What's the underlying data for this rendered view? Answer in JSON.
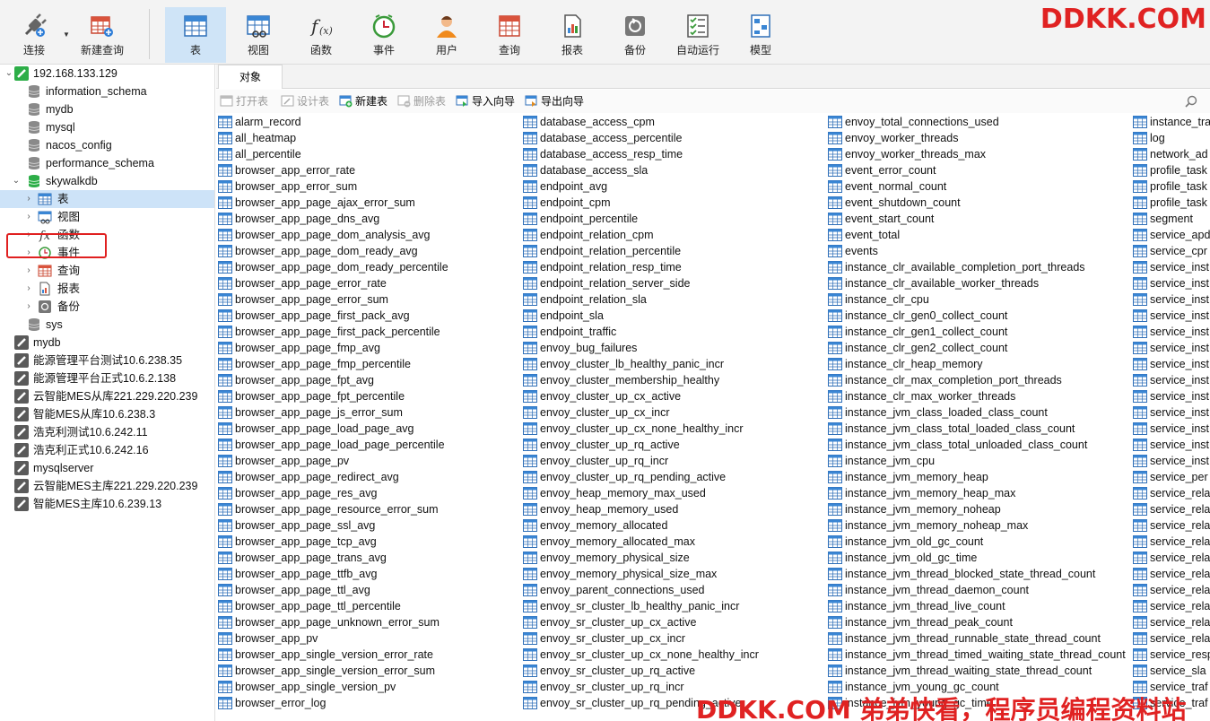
{
  "toolbar": {
    "buttons": [
      {
        "label": "连接",
        "icon": "plug-icon"
      },
      {
        "label": "新建查询",
        "icon": "new-query-icon"
      },
      {
        "label": "表",
        "icon": "table-icon"
      },
      {
        "label": "视图",
        "icon": "view-icon"
      },
      {
        "label": "函数",
        "icon": "function-icon"
      },
      {
        "label": "事件",
        "icon": "clock-icon"
      },
      {
        "label": "用户",
        "icon": "user-icon"
      },
      {
        "label": "查询",
        "icon": "query-icon"
      },
      {
        "label": "报表",
        "icon": "report-icon"
      },
      {
        "label": "备份",
        "icon": "backup-icon"
      },
      {
        "label": "自动运行",
        "icon": "auto-run-icon"
      },
      {
        "label": "模型",
        "icon": "model-icon"
      }
    ]
  },
  "watermark": {
    "top": "DDKK.COM",
    "bottom": "DDKK.COM 弟弟快看，程序员编程资料站"
  },
  "sidebar": {
    "connection": "192.168.133.129",
    "databases": [
      "information_schema",
      "mydb",
      "mysql",
      "nacos_config",
      "performance_schema"
    ],
    "open_db": "skywalkdb",
    "open_db_children": [
      "表",
      "视图",
      "函数",
      "事件",
      "查询",
      "报表",
      "备份"
    ],
    "after_db": "sys",
    "connections": [
      "mydb",
      "能源管理平台测试10.6.238.35",
      "能源管理平台正式10.6.2.138",
      "云智能MES从库221.229.220.239",
      "智能MES从库10.6.238.3",
      "浩克利测试10.6.242.11",
      "浩克利正式10.6.242.16",
      "mysqlserver",
      "云智能MES主库221.229.220.239",
      "智能MES主库10.6.239.13"
    ]
  },
  "tabs": {
    "objects": "对象"
  },
  "subtoolbar": {
    "open_table": "打开表",
    "design_table": "设计表",
    "new_table": "新建表",
    "delete_table": "删除表",
    "import_wizard": "导入向导",
    "export_wizard": "导出向导"
  },
  "tables": {
    "col1": [
      "alarm_record",
      "all_heatmap",
      "all_percentile",
      "browser_app_error_rate",
      "browser_app_error_sum",
      "browser_app_page_ajax_error_sum",
      "browser_app_page_dns_avg",
      "browser_app_page_dom_analysis_avg",
      "browser_app_page_dom_ready_avg",
      "browser_app_page_dom_ready_percentile",
      "browser_app_page_error_rate",
      "browser_app_page_error_sum",
      "browser_app_page_first_pack_avg",
      "browser_app_page_first_pack_percentile",
      "browser_app_page_fmp_avg",
      "browser_app_page_fmp_percentile",
      "browser_app_page_fpt_avg",
      "browser_app_page_fpt_percentile",
      "browser_app_page_js_error_sum",
      "browser_app_page_load_page_avg",
      "browser_app_page_load_page_percentile",
      "browser_app_page_pv",
      "browser_app_page_redirect_avg",
      "browser_app_page_res_avg",
      "browser_app_page_resource_error_sum",
      "browser_app_page_ssl_avg",
      "browser_app_page_tcp_avg",
      "browser_app_page_trans_avg",
      "browser_app_page_ttfb_avg",
      "browser_app_page_ttl_avg",
      "browser_app_page_ttl_percentile",
      "browser_app_page_unknown_error_sum",
      "browser_app_pv",
      "browser_app_single_version_error_rate",
      "browser_app_single_version_error_sum",
      "browser_app_single_version_pv",
      "browser_error_log"
    ],
    "col2": [
      "database_access_cpm",
      "database_access_percentile",
      "database_access_resp_time",
      "database_access_sla",
      "endpoint_avg",
      "endpoint_cpm",
      "endpoint_percentile",
      "endpoint_relation_cpm",
      "endpoint_relation_percentile",
      "endpoint_relation_resp_time",
      "endpoint_relation_server_side",
      "endpoint_relation_sla",
      "endpoint_sla",
      "endpoint_traffic",
      "envoy_bug_failures",
      "envoy_cluster_lb_healthy_panic_incr",
      "envoy_cluster_membership_healthy",
      "envoy_cluster_up_cx_active",
      "envoy_cluster_up_cx_incr",
      "envoy_cluster_up_cx_none_healthy_incr",
      "envoy_cluster_up_rq_active",
      "envoy_cluster_up_rq_incr",
      "envoy_cluster_up_rq_pending_active",
      "envoy_heap_memory_max_used",
      "envoy_heap_memory_used",
      "envoy_memory_allocated",
      "envoy_memory_allocated_max",
      "envoy_memory_physical_size",
      "envoy_memory_physical_size_max",
      "envoy_parent_connections_used",
      "envoy_sr_cluster_lb_healthy_panic_incr",
      "envoy_sr_cluster_up_cx_active",
      "envoy_sr_cluster_up_cx_incr",
      "envoy_sr_cluster_up_cx_none_healthy_incr",
      "envoy_sr_cluster_up_rq_active",
      "envoy_sr_cluster_up_rq_incr",
      "envoy_sr_cluster_up_rq_pending_active"
    ],
    "col3": [
      "envoy_total_connections_used",
      "envoy_worker_threads",
      "envoy_worker_threads_max",
      "event_error_count",
      "event_normal_count",
      "event_shutdown_count",
      "event_start_count",
      "event_total",
      "events",
      "instance_clr_available_completion_port_threads",
      "instance_clr_available_worker_threads",
      "instance_clr_cpu",
      "instance_clr_gen0_collect_count",
      "instance_clr_gen1_collect_count",
      "instance_clr_gen2_collect_count",
      "instance_clr_heap_memory",
      "instance_clr_max_completion_port_threads",
      "instance_clr_max_worker_threads",
      "instance_jvm_class_loaded_class_count",
      "instance_jvm_class_total_loaded_class_count",
      "instance_jvm_class_total_unloaded_class_count",
      "instance_jvm_cpu",
      "instance_jvm_memory_heap",
      "instance_jvm_memory_heap_max",
      "instance_jvm_memory_noheap",
      "instance_jvm_memory_noheap_max",
      "instance_jvm_old_gc_count",
      "instance_jvm_old_gc_time",
      "instance_jvm_thread_blocked_state_thread_count",
      "instance_jvm_thread_daemon_count",
      "instance_jvm_thread_live_count",
      "instance_jvm_thread_peak_count",
      "instance_jvm_thread_runnable_state_thread_count",
      "instance_jvm_thread_timed_waiting_state_thread_count",
      "instance_jvm_thread_waiting_state_thread_count",
      "instance_jvm_young_gc_count",
      "instance_jvm_young_gc_time"
    ],
    "col4": [
      "instance_tra",
      "log",
      "network_ad",
      "profile_task",
      "profile_task",
      "profile_task",
      "segment",
      "service_apd",
      "service_cpr",
      "service_inst",
      "service_inst",
      "service_inst",
      "service_inst",
      "service_inst",
      "service_inst",
      "service_inst",
      "service_inst",
      "service_inst",
      "service_inst",
      "service_inst",
      "service_inst",
      "service_inst",
      "service_per",
      "service_rela",
      "service_rela",
      "service_rela",
      "service_rela",
      "service_rela",
      "service_rela",
      "service_rela",
      "service_rela",
      "service_rela",
      "service_rela",
      "service_resp",
      "service_sla",
      "service_traf",
      "service_traf"
    ]
  }
}
